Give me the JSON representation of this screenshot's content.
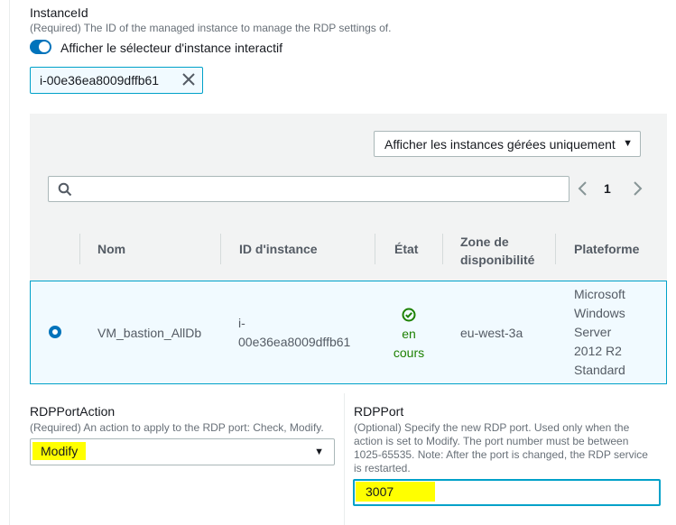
{
  "instance_id": {
    "label": "InstanceId",
    "description": "(Required) The ID of the managed instance to manage the RDP settings of.",
    "toggle_label": "Afficher le sélecteur d'instance interactif",
    "selected_token": "i-00e36ea8009dffb61"
  },
  "selector": {
    "filter_dropdown": "Afficher les instances gérées uniquement",
    "search_placeholder": "",
    "page": "1",
    "columns": {
      "name": "Nom",
      "instance_id": "ID d'instance",
      "state": "État",
      "zone": [
        "Zone de",
        "disponibilité"
      ],
      "platform": "Plateforme"
    },
    "rows": [
      {
        "name": "VM_bastion_AllDb",
        "instance_id": [
          "i-",
          "00e36ea8009dffb61"
        ],
        "state": [
          "en",
          "cours"
        ],
        "zone": "eu-west-3a",
        "platform": [
          "Microsoft",
          "Windows",
          "Server",
          "2012 R2",
          "Standard"
        ]
      }
    ]
  },
  "rdp_port_action": {
    "label": "RDPPortAction",
    "description": "(Required) An action to apply to the RDP port: Check, Modify.",
    "value": "Modify"
  },
  "rdp_port": {
    "label": "RDPPort",
    "description": [
      "(Optional) Specify the new RDP port. Used only when the",
      "action is set to Modify. The port number must be between",
      "1025-65535. Note: After the port is changed, the RDP service",
      "is restarted."
    ],
    "value": "3007"
  },
  "colors": {
    "accent": "#0073bb",
    "selection_border": "#00a1c9",
    "success": "#1d8102",
    "highlight": "#ffff00"
  }
}
